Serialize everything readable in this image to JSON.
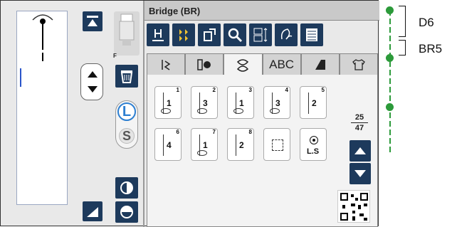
{
  "window": {
    "title": "Bridge (BR)"
  },
  "preview": {
    "presser_foot": "F"
  },
  "length_toggle": {
    "long": "L",
    "short": "S"
  },
  "tabs": [
    {
      "icon": "utility-stitch-icon",
      "label": ""
    },
    {
      "icon": "buttonhole-icon",
      "label": ""
    },
    {
      "icon": "decorative-stitch-icon",
      "label": ""
    },
    {
      "icon": "",
      "label": "ABC"
    },
    {
      "icon": "satin-stitch-icon",
      "label": ""
    },
    {
      "icon": "shirt-icon",
      "label": ""
    }
  ],
  "stitches": [
    {
      "num": "1",
      "val": "1"
    },
    {
      "num": "2",
      "val": "3"
    },
    {
      "num": "3",
      "val": "1"
    },
    {
      "num": "4",
      "val": "3"
    },
    {
      "num": "5",
      "val": "2"
    },
    {
      "num": "6",
      "val": "4"
    },
    {
      "num": "7",
      "val": "1"
    },
    {
      "num": "8",
      "val": "2"
    },
    {
      "num": "",
      "val": ""
    },
    {
      "num": "",
      "val": "L.S"
    }
  ],
  "pagination": {
    "current": "25",
    "total": "47"
  },
  "annotations": {
    "upper": "D6",
    "lower": "BR5"
  },
  "colors": {
    "button": "#1d3a5c",
    "accent_green": "#2c9a3a",
    "accent_blue": "#2d7fd1"
  }
}
